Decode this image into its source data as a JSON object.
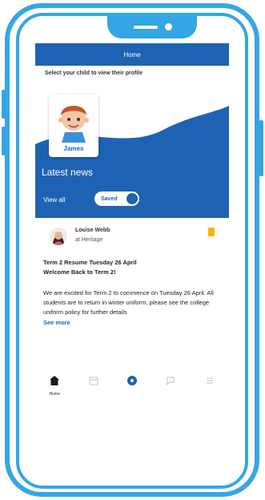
{
  "header": {
    "title": "Home"
  },
  "prompt": "Select your child to view their profile",
  "child": {
    "name": "James"
  },
  "news": {
    "title": "Latest news",
    "tabs": {
      "view_all": "View all",
      "saved": "Saved"
    }
  },
  "post": {
    "author": "Louise Webb",
    "role": "at Heritage",
    "title_line1": "Term 2 Resume Tuesday 26 April",
    "title_line2": "Welcome Back to Term 2!",
    "body": "We are excited for Term 2 to commence on Tuesday 26 April. All students are to return in winter uniform, please see the college uniform policy for further details",
    "see_more": "See more"
  },
  "bottom_nav": {
    "home": "Home",
    "calendar": "",
    "center": "",
    "messages": "",
    "more": ""
  },
  "colors": {
    "frame": "#35a6e5",
    "primary": "#1e63b3",
    "bookmark": "#f6b700"
  },
  "icons": [
    "home-icon",
    "calendar-icon",
    "center-dot-icon",
    "chat-icon",
    "menu-icon",
    "bookmark-icon"
  ]
}
